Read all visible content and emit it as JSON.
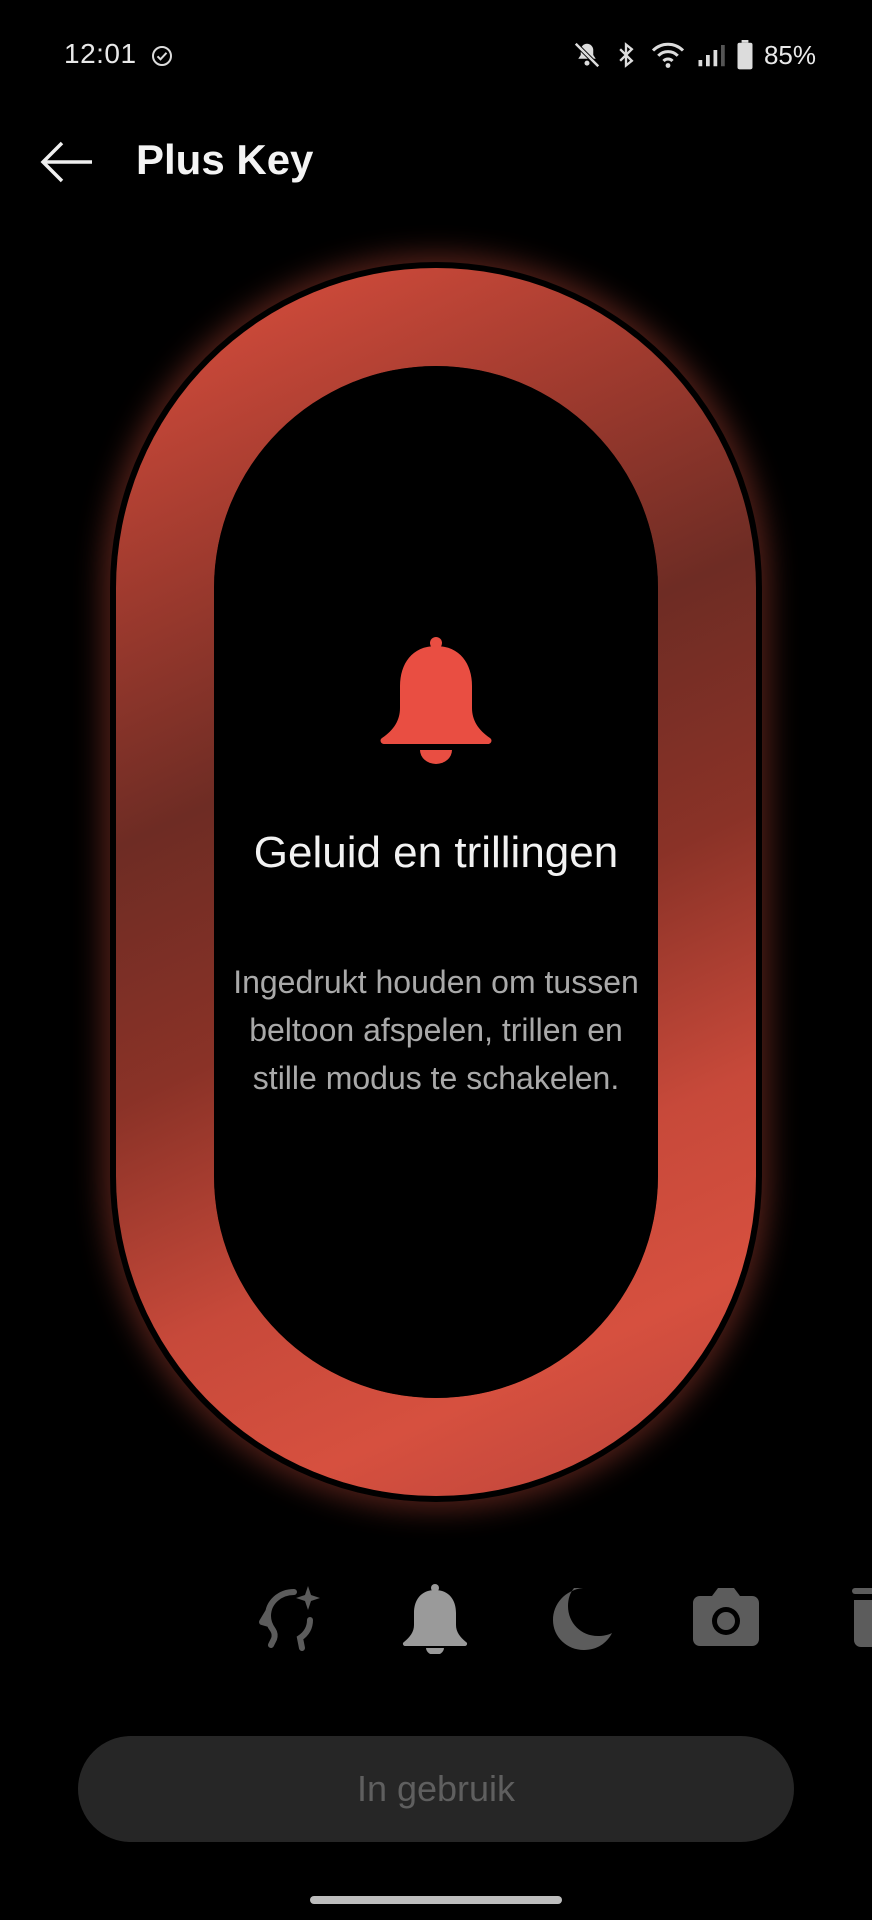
{
  "status_bar": {
    "time": "12:01",
    "battery": "85%",
    "icons": [
      "check-circle-icon",
      "bell-muted-icon",
      "bluetooth-icon",
      "wifi-icon",
      "signal-icon",
      "battery-icon"
    ]
  },
  "header": {
    "title": "Plus Key",
    "back_icon": "arrow-left-icon"
  },
  "feature": {
    "icon": "bell-icon",
    "title": "Geluid en trillingen",
    "description": "Ingedrukt houden om tussen beltoon afspelen, trillen en stille modus te schakelen."
  },
  "modes": [
    {
      "icon": "ai-sparkle-icon",
      "selected": false
    },
    {
      "icon": "bell-icon",
      "selected": true
    },
    {
      "icon": "moon-icon",
      "selected": false
    },
    {
      "icon": "camera-icon",
      "selected": false
    },
    {
      "icon": "partial-icon",
      "selected": false
    }
  ],
  "action_button": {
    "label": "In gebruik"
  },
  "colors": {
    "accent": "#e94e42",
    "ring": "#c7493a",
    "background": "#000000",
    "button_bg": "#262626",
    "button_text": "#5f5f5f"
  }
}
